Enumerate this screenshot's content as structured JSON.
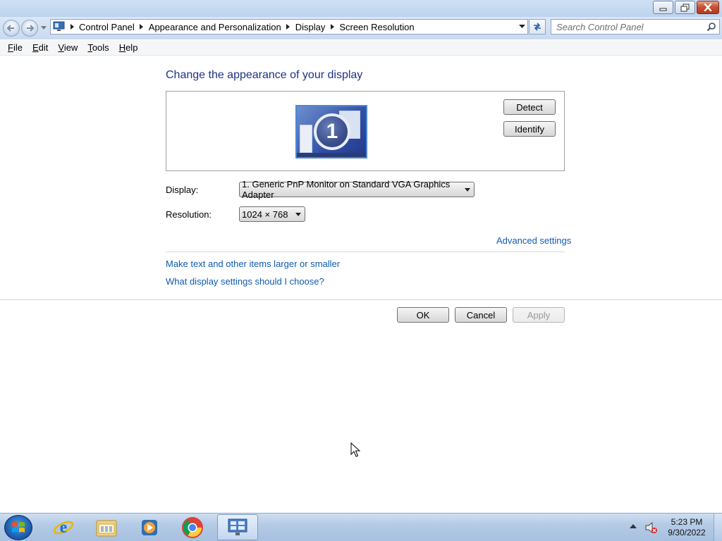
{
  "window": {
    "title": "Screen Resolution",
    "controls": {
      "minimize": "minimize",
      "maximize": "restore",
      "close": "close"
    }
  },
  "address_bar": {
    "breadcrumbs": [
      {
        "label": "Control Panel"
      },
      {
        "label": "Appearance and Personalization"
      },
      {
        "label": "Display"
      },
      {
        "label": "Screen Resolution"
      }
    ]
  },
  "search": {
    "placeholder": "Search Control Panel"
  },
  "menu": {
    "items": [
      {
        "label": "File",
        "accel": "F",
        "rest": "ile"
      },
      {
        "label": "Edit",
        "accel": "E",
        "rest": "dit"
      },
      {
        "label": "View",
        "accel": "V",
        "rest": "iew"
      },
      {
        "label": "Tools",
        "accel": "T",
        "rest": "ools"
      },
      {
        "label": "Help",
        "accel": "H",
        "rest": "elp"
      }
    ]
  },
  "main": {
    "heading": "Change the appearance of your display",
    "monitor_number": "1",
    "detect_label": "Detect",
    "identify_label": "Identify",
    "display_label": "Display:",
    "display_value": "1. Generic PnP Monitor on Standard VGA Graphics Adapter",
    "resolution_label": "Resolution:",
    "resolution_value": "1024 × 768",
    "advanced_settings_link": "Advanced settings",
    "text_size_link": "Make text and other items larger or smaller",
    "which_settings_link": "What display settings should I choose?",
    "ok_label": "OK",
    "cancel_label": "Cancel",
    "apply_label": "Apply",
    "apply_enabled": false
  },
  "taskbar": {
    "apps": [
      {
        "name": "internet-explorer-icon"
      },
      {
        "name": "windows-explorer-icon"
      },
      {
        "name": "media-player-icon"
      },
      {
        "name": "chrome-icon"
      },
      {
        "name": "control-panel-icon",
        "active": true
      }
    ],
    "clock": {
      "time": "5:23 PM",
      "date": "9/30/2022"
    }
  },
  "colors": {
    "heading": "#1e3287",
    "link": "#0f5bb0",
    "close_button": "#c75235"
  }
}
